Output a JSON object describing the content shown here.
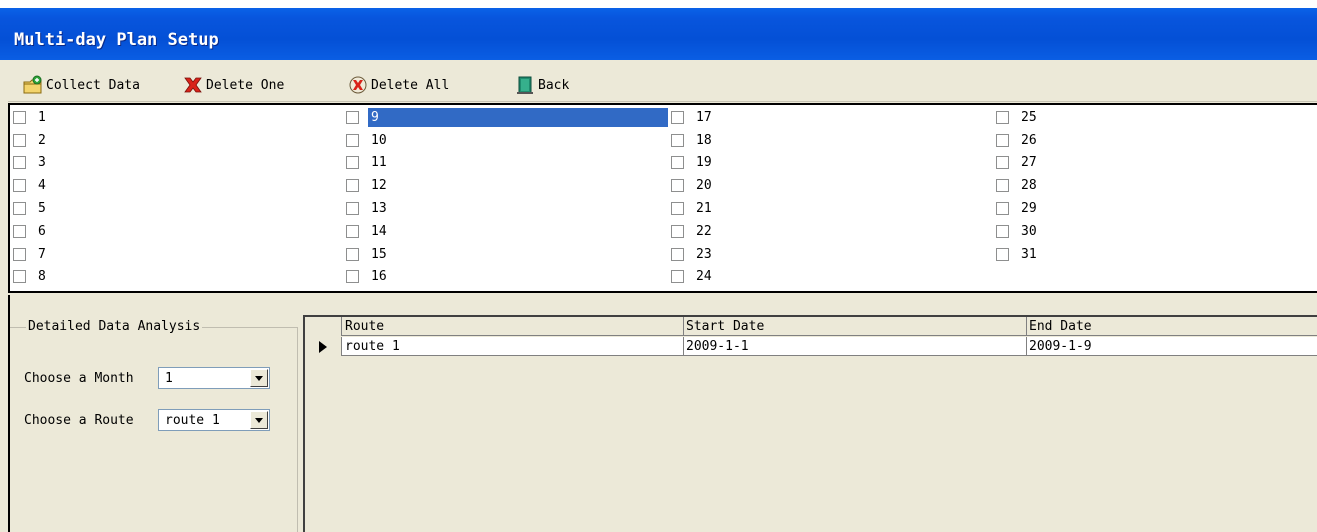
{
  "window": {
    "title": "Multi-day Plan Setup"
  },
  "toolbar": {
    "collect_label": "Collect Data",
    "delete_one_label": "Delete One",
    "delete_all_label": "Delete All",
    "back_label": "Back"
  },
  "days": {
    "columns": [
      [
        "1",
        "2",
        "3",
        "4",
        "5",
        "6",
        "7",
        "8"
      ],
      [
        "9",
        "10",
        "11",
        "12",
        "13",
        "14",
        "15",
        "16"
      ],
      [
        "17",
        "18",
        "19",
        "20",
        "21",
        "22",
        "23",
        "24"
      ],
      [
        "25",
        "26",
        "27",
        "28",
        "29",
        "30",
        "31"
      ]
    ],
    "selected": "9"
  },
  "analysis": {
    "group_title": "Detailed Data Analysis",
    "month_label": "Choose a Month",
    "month_value": "1",
    "route_label": "Choose a Route",
    "route_value": "route 1"
  },
  "grid": {
    "columns": [
      "Route",
      "Start Date",
      "End Date"
    ],
    "rows": [
      {
        "route": "route 1",
        "start": "2009-1-1",
        "end": "2009-1-9"
      }
    ]
  },
  "colors": {
    "title_bar": "#0A5EE4",
    "selection": "#316AC5",
    "face": "#ECE9D8"
  }
}
